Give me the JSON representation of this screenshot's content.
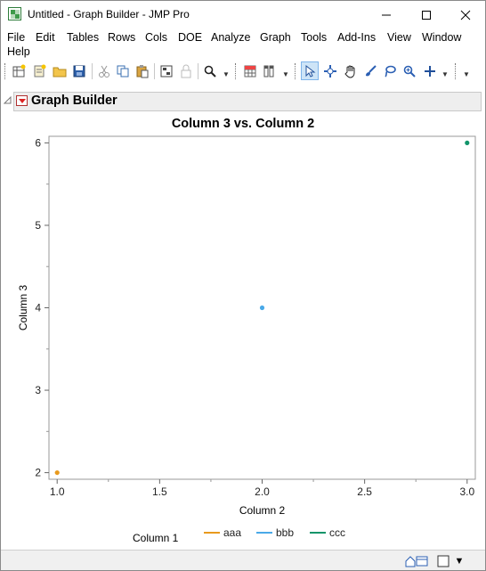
{
  "window": {
    "title": "Untitled - Graph Builder - JMP Pro",
    "controls": [
      "minimize",
      "maximize",
      "close"
    ]
  },
  "menu": [
    "File",
    "Edit",
    "Tables",
    "Rows",
    "Cols",
    "DOE",
    "Analyze",
    "Graph",
    "Tools",
    "Add-Ins",
    "View",
    "Window",
    "Help"
  ],
  "toolbar": {
    "icons": [
      "new-table-icon",
      "new-script-icon",
      "open-icon",
      "save-icon",
      "cut-icon",
      "copy-icon",
      "paste-icon",
      "data-table-icon",
      "lock-icon",
      "search-icon",
      "table-grid-icon",
      "columns-icon",
      "arrow-select-icon",
      "crosshair-icon",
      "hand-icon",
      "brush-icon",
      "lasso-icon",
      "magnifier-icon",
      "plus-icon"
    ]
  },
  "outline": {
    "title": "Graph Builder"
  },
  "chart_data": {
    "type": "scatter",
    "title": "Column 3 vs. Column 2",
    "xlabel": "Column 2",
    "ylabel": "Column 3",
    "xlim": [
      0.96,
      3.04
    ],
    "ylim": [
      1.92,
      6.08
    ],
    "xticks": [
      "1.0",
      "1.5",
      "2.0",
      "2.5",
      "3.0"
    ],
    "xtick_values": [
      1.0,
      1.5,
      2.0,
      2.5,
      3.0
    ],
    "yticks": [
      "2",
      "3",
      "4",
      "5",
      "6"
    ],
    "ytick_values": [
      2,
      3,
      4,
      5,
      6
    ],
    "grid": false,
    "legend_title": "Column 1",
    "legend_position": "bottom",
    "series": [
      {
        "name": "aaa",
        "color": "#e89a1d",
        "x": [
          1.0
        ],
        "y": [
          2
        ]
      },
      {
        "name": "bbb",
        "color": "#4aa9e8",
        "x": [
          2.0
        ],
        "y": [
          4
        ]
      },
      {
        "name": "ccc",
        "color": "#12946a",
        "x": [
          3.0
        ],
        "y": [
          6
        ]
      }
    ]
  }
}
